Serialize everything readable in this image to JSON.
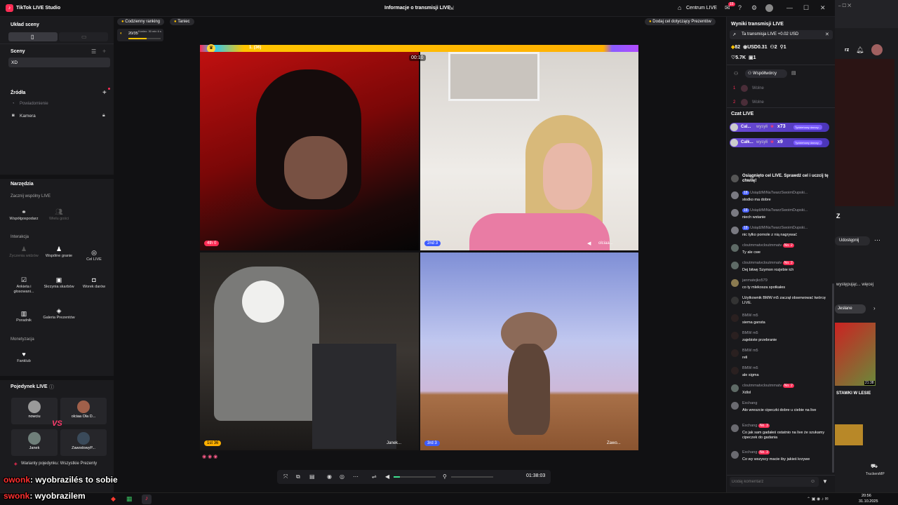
{
  "titlebar": {
    "app_name": "TikTok LIVE Studio",
    "center_title": "Informacje o transmisji LIVE",
    "centrum_label": "Centrum LIVE",
    "notif_count": "15",
    "colors": {
      "accent": "#ff2d55"
    }
  },
  "left": {
    "layout_title": "Układ sceny",
    "scenes_title": "Sceny",
    "scene_item": "XD",
    "sources_title": "Źródła",
    "source_placeholder": "Powiadomienie",
    "source_camera": "Kamera",
    "tools_title": "Narzędzia",
    "colive_title": "Zacznij wspólny LIVE",
    "tool_cohost": "Współgospodarz",
    "tool_multi": "Wielu gości",
    "interaction_title": "Interakcja",
    "tool_wishes": "Życzenia widzów",
    "tool_play": "Wspólne granie",
    "tool_goal": "Cel LIVE",
    "tool_poll": "Ankieta i głosowani...",
    "tool_chest": "Skrzynia skarbów",
    "tool_bag": "Worek darów",
    "tool_guide": "Poradnik",
    "tool_gallery": "Galeria Prezentów",
    "monet_title": "Monetyzacja",
    "tool_fanclub": "Fanklub",
    "duel_title": "Pojedynek LIVE",
    "duel_players": [
      "nowciu",
      "olciaa Ola D...",
      "Janek",
      "ZawodowyP..."
    ],
    "duel_variants": "Warianty pojedynku: Wszystkie Prezenty"
  },
  "center": {
    "pill_ranking": "Codzienny ranking",
    "pill_dance": "Taniec",
    "mini_score": "20/35",
    "mini_time": "Koniec: 30 min 6 s",
    "add_goal": "Dodaj cel dotyczący Prezentów",
    "top_bar_rank": "1. (36)",
    "timer": "00:10",
    "tiles": [
      {
        "rank": "4th",
        "score": "0",
        "name": ""
      },
      {
        "rank": "2nd",
        "score": "3",
        "name": "olciaa..."
      },
      {
        "rank": "1st",
        "score": "36",
        "name": "Janek..."
      },
      {
        "rank": "3rd",
        "score": "3",
        "name": "Zawo..."
      }
    ],
    "duration": "01:38:03",
    "mic_level": 0.15
  },
  "right": {
    "results_title": "Wyniki transmisji LIVE",
    "banner": "Ta transmisja LIVE +0.02 USD",
    "stat_diamonds": "82",
    "stat_usd": "USD0.31",
    "stat_people": "2",
    "stat_follow": "1",
    "stat_likes": "5.7K",
    "stat_share": "1",
    "collab_label": "Współtwórcy",
    "slot1": "Wolne",
    "slot2": "Wolne",
    "chat_title": "Czat LIVE",
    "gift1_user": "Cal...",
    "gift1_verb": "wysyłi",
    "gift1_count": "x73",
    "gift1_tag": "Tydzieńowy darczy...",
    "gift2_user": "Całk...",
    "gift2_verb": "wysyłi",
    "gift2_count": "x9",
    "gift2_tag": "Tydzieńowy darczy...",
    "messages": [
      {
        "user": "",
        "text": "Osiągnięto cel LIVE. Sprawdź cel i uczcij tę chwilę!",
        "lvl": ""
      },
      {
        "user": "UsiądźMiNaTwarzSwoimDupski...",
        "text": "słodko ma dobre",
        "lvl": "18"
      },
      {
        "user": "UsiądźMiNaTwarzSwoimDupski...",
        "text": "niech wstanie",
        "lvl": "18"
      },
      {
        "user": "UsiądźMiNaTwarzSwoimDupski...",
        "text": "nic tylko pornole z nią nagrywać",
        "lvl": "18"
      },
      {
        "user": "cloutmmatvcloutmmatv",
        "text": "Ty ale cwe",
        "lvl": "No. 2"
      },
      {
        "user": "cloutmmatvcloutmmatv",
        "text": "Dej bitwę Szymon rozjebie ich",
        "lvl": "No. 2"
      },
      {
        "user": "janmatejko579",
        "text": "co ty mlekosza spotkałes",
        "lvl": ""
      },
      {
        "user": "Użytkownik BMW m5 zaczął obserwować twórcę LIVE.",
        "text": "",
        "lvl": ""
      },
      {
        "user": "BMW m5",
        "text": "siema gansta",
        "lvl": ""
      },
      {
        "user": "BMW m5",
        "text": "zajebiste przebranie",
        "lvl": ""
      },
      {
        "user": "BMW m5",
        "text": "reli",
        "lvl": ""
      },
      {
        "user": "BMW m5",
        "text": "ale sigma",
        "lvl": ""
      },
      {
        "user": "cloutmmatvcloutmmatv",
        "text": "Xdlol",
        "lvl": "No. 2"
      },
      {
        "user": "Exchang",
        "text": "Ało wreszcie cipeczki dobre u ciebie na live",
        "lvl": ""
      },
      {
        "user": "Exchang",
        "text": "Co jak sam gadałeś ostatnio na live że szukamy cipeczek do gadania",
        "lvl": "No. 3"
      },
      {
        "user": "Exchang",
        "text": "Co wy wszyscy macie iby jakieś krzywe",
        "lvl": "No. 3"
      }
    ],
    "comment_placeholder": "Dodaj komentarz"
  },
  "browser": {
    "share_label": "Udostępnij",
    "more_label": "występując... więcej",
    "tab_label": "Jesłane",
    "video_caption": "STAWKI W LESIE",
    "video_time": "21:38",
    "z_letter": "Z",
    "rz": "rz"
  },
  "overlay": {
    "line1_user": "owonk",
    "line1_text": ": wyobrazilés to sobie",
    "line2_user": "swonk",
    "line2_text": ": wyobrazilem"
  },
  "taskbar": {
    "time": "20:56",
    "date": "31.10.2025",
    "app_label": "TruckersMP"
  }
}
